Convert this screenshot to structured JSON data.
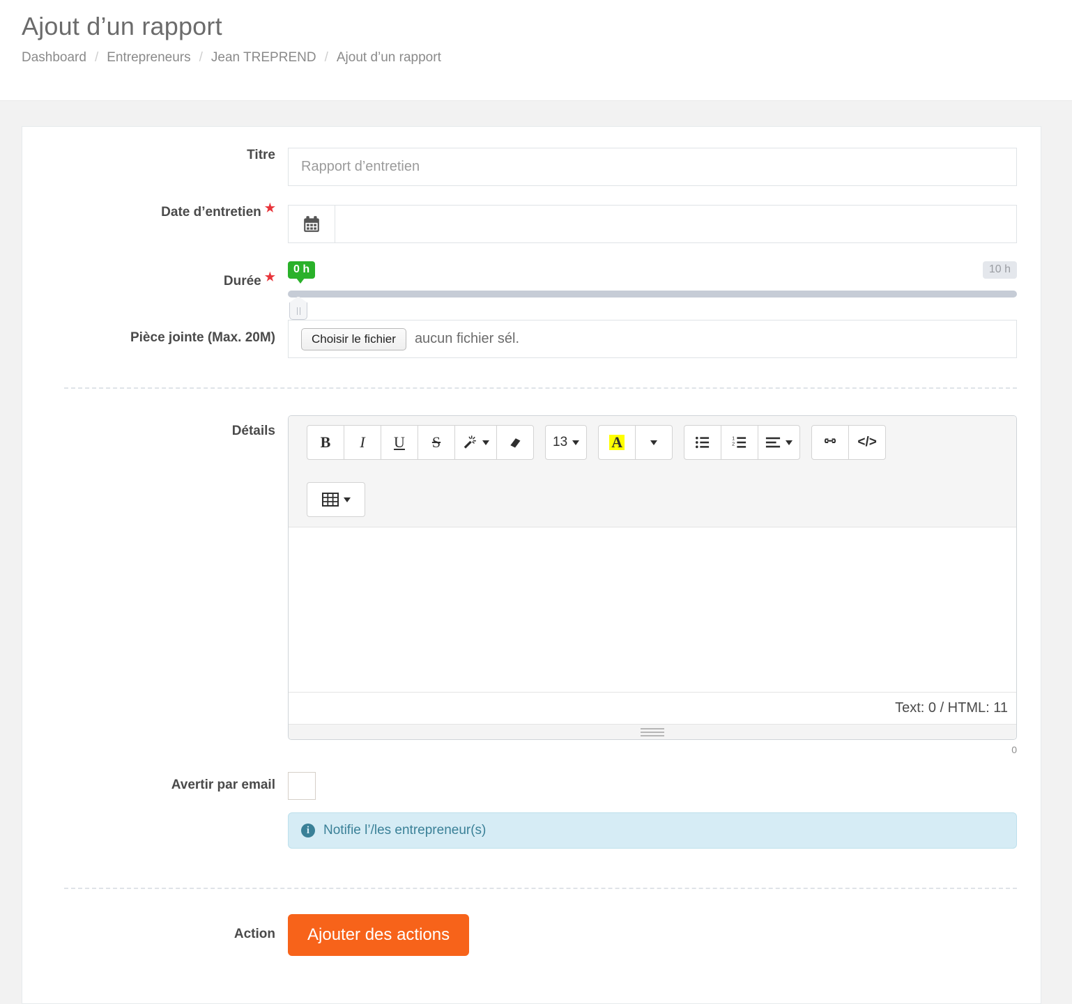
{
  "header": {
    "title": "Ajout d’un rapport",
    "breadcrumb": [
      {
        "label": "Dashboard"
      },
      {
        "label": "Entrepreneurs"
      },
      {
        "label": "Jean TREPREND"
      },
      {
        "label": "Ajout d’un rapport"
      }
    ],
    "separator": "/"
  },
  "form": {
    "titre": {
      "label": "Titre",
      "placeholder": "Rapport d’entretien",
      "value": ""
    },
    "date_entretien": {
      "label": "Date d’entretien",
      "required_marker": "★",
      "value": "",
      "icon": "calendar-icon"
    },
    "duree": {
      "label": "Durée",
      "required_marker": "★",
      "current_value": "0 h",
      "max_value": "10 h",
      "min": 0,
      "max": 10,
      "value": 0
    },
    "piece_jointe": {
      "label": "Pièce jointe (Max. 20M)",
      "button_label": "Choisir le fichier",
      "status": "aucun fichier sél."
    },
    "details": {
      "label": "Détails",
      "content": "",
      "status_text": "Text: 0 / HTML: 11",
      "counter": "0",
      "toolbar": {
        "groups": [
          {
            "buttons": [
              {
                "name": "bold-icon",
                "glyph": "B",
                "style": "bold"
              },
              {
                "name": "italic-icon",
                "glyph": "I",
                "style": "italic"
              },
              {
                "name": "underline-icon",
                "glyph": "U",
                "style": "underline"
              },
              {
                "name": "strikethrough-icon",
                "glyph": "S",
                "style": "strike"
              },
              {
                "name": "magic-wand-icon",
                "glyph": "magic",
                "caret": true
              },
              {
                "name": "eraser-icon",
                "glyph": "eraser"
              }
            ]
          },
          {
            "buttons": [
              {
                "name": "font-size-dropdown",
                "glyph": "13",
                "caret": true
              }
            ]
          },
          {
            "buttons": [
              {
                "name": "highlight-color-icon",
                "glyph": "A"
              },
              {
                "name": "highlight-color-dropdown",
                "glyph": "",
                "caret": true
              }
            ]
          },
          {
            "buttons": [
              {
                "name": "unordered-list-icon",
                "glyph": "ul"
              },
              {
                "name": "ordered-list-icon",
                "glyph": "ol"
              },
              {
                "name": "paragraph-align-icon",
                "glyph": "align",
                "caret": true
              }
            ]
          },
          {
            "buttons": [
              {
                "name": "link-icon",
                "glyph": "link"
              },
              {
                "name": "code-view-icon",
                "glyph": "</>"
              }
            ]
          },
          {
            "buttons": [
              {
                "name": "table-icon",
                "glyph": "table",
                "caret": true
              }
            ]
          }
        ]
      }
    },
    "avertir": {
      "label": "Avertir par email",
      "checked": false,
      "alert_text": "Notifie l’/les entrepreneur(s)",
      "alert_icon": "info-icon"
    },
    "action": {
      "label": "Action",
      "button_label": "Ajouter des actions"
    }
  },
  "colors": {
    "accent_orange": "#f7631a",
    "required_red": "#e8343a",
    "slider_green": "#2ab12a",
    "alert_bg": "#d6ecf5",
    "alert_text": "#3a8097",
    "highlight_yellow": "#ffff00"
  }
}
